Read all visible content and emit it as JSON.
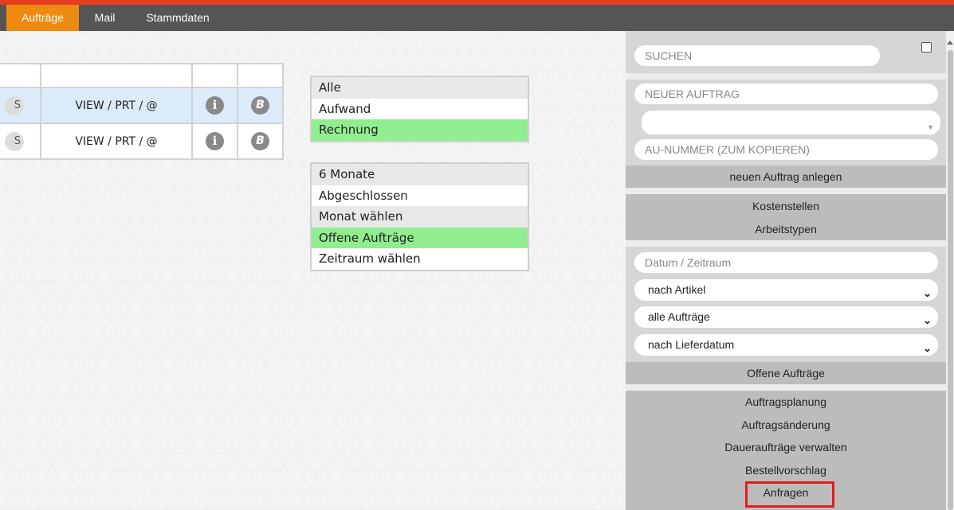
{
  "nav": {
    "tabs": [
      {
        "label": "Aufträge",
        "active": true
      },
      {
        "label": "Mail",
        "active": false
      },
      {
        "label": "Stammdaten",
        "active": false
      }
    ],
    "accent_color": "#ee8a12",
    "top_stripe_color": "#e43d1f"
  },
  "table": {
    "rows": [
      {
        "status": "S",
        "actions": "VIEW / PRT / @",
        "info_icon": "info-icon",
        "b_icon": "b-icon",
        "selected": true
      },
      {
        "status": "S",
        "actions": "VIEW / PRT / @",
        "info_icon": "info-icon",
        "b_icon": "b-icon",
        "selected": false
      }
    ]
  },
  "filters": {
    "type": {
      "options": [
        {
          "label": "Alle",
          "state": "grey"
        },
        {
          "label": "Aufwand",
          "state": "plain"
        },
        {
          "label": "Rechnung",
          "state": "selected"
        }
      ]
    },
    "period": {
      "options": [
        {
          "label": "6 Monate",
          "state": "grey"
        },
        {
          "label": "Abgeschlossen",
          "state": "plain"
        },
        {
          "label": "Monat wählen",
          "state": "grey"
        },
        {
          "label": "Offene Aufträge",
          "state": "selected"
        },
        {
          "label": "Zeitraum wählen",
          "state": "plain"
        }
      ]
    },
    "selected_color": "#90ee90"
  },
  "panel": {
    "search_placeholder": "SUCHEN",
    "new_order_placeholder": "NEUER AUFTRAG",
    "order_select_value": "",
    "order_number_placeholder": "AU-NUMMER (ZUM KOPIEREN)",
    "create_order_label": "neuen Auftrag anlegen",
    "cost_centers_label": "Kostenstellen",
    "work_types_label": "Arbeitstypen",
    "date_range_placeholder": "Datum / Zeitraum",
    "group_select": "nach Artikel",
    "orders_select": "alle Aufträge",
    "sort_select": "nach Lieferdatum",
    "open_orders_label": "Offene Aufträge",
    "links": [
      "Auftragsplanung",
      "Auftragsänderung",
      "Daueraufträge verwalten",
      "Bestellvorschlag",
      "Anfragen"
    ]
  }
}
